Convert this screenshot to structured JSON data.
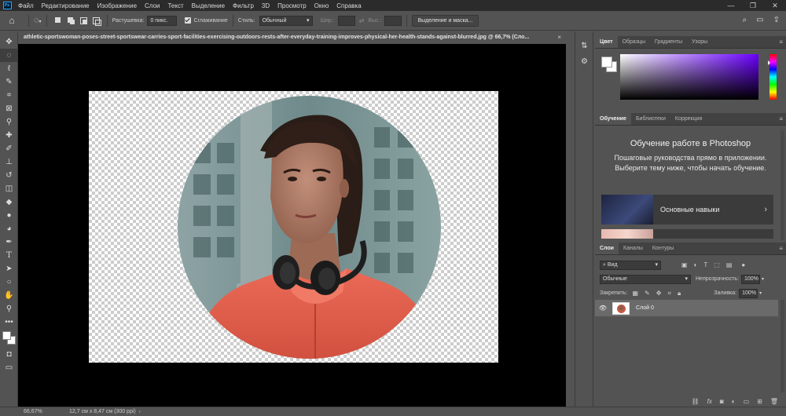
{
  "menubar": {
    "items": [
      "Файл",
      "Редактирование",
      "Изображение",
      "Слои",
      "Текст",
      "Выделение",
      "Фильтр",
      "3D",
      "Просмотр",
      "Окно",
      "Справка"
    ],
    "logo_text": "Ps",
    "window_controls": [
      "—",
      "❐",
      "✕"
    ]
  },
  "options": {
    "feather_label": "Растушевка:",
    "feather_value": "0 пикс.",
    "antialias_label": "Сглаживание",
    "style_label": "Стиль:",
    "style_value": "Обычный",
    "width_label": "Шир.:",
    "height_label": "Выс.:",
    "select_mask_button": "Выделение и маска..."
  },
  "document": {
    "tab_title": "athletic-sportswoman-poses-street-sportswear-carries-sport-facilities-exercising-outdoors-rests-after-everyday-training-improves-physical-her-health-stands-against-blurred.jpg @ 66,7% (Сло...",
    "close": "×"
  },
  "status": {
    "zoom": "66,67%",
    "doc_info": "12,7 см x 8,47 см (300 ppi)"
  },
  "color_panel": {
    "tabs": [
      "Цвет",
      "Образцы",
      "Градиенты",
      "Узоры"
    ],
    "accent_hue": "#6a00ff"
  },
  "learn_panel": {
    "tabs": [
      "Обучение",
      "Библиотеки",
      "Коррекция"
    ],
    "title": "Обучение работе в Photoshop",
    "text": "Пошаговые руководства прямо в приложении. Выберите тему ниже, чтобы начать обучение.",
    "card_label": "Основные навыки"
  },
  "layers_panel": {
    "tabs": [
      "Слои",
      "Каналы",
      "Контуры"
    ],
    "filter_value": "Вид",
    "blend_mode": "Обычные",
    "opacity_label": "Непрозрачность:",
    "opacity_value": "100%",
    "lock_label": "Закрепить:",
    "fill_label": "Заливка:",
    "fill_value": "100%",
    "layers": [
      {
        "name": "Слой 0"
      }
    ]
  }
}
